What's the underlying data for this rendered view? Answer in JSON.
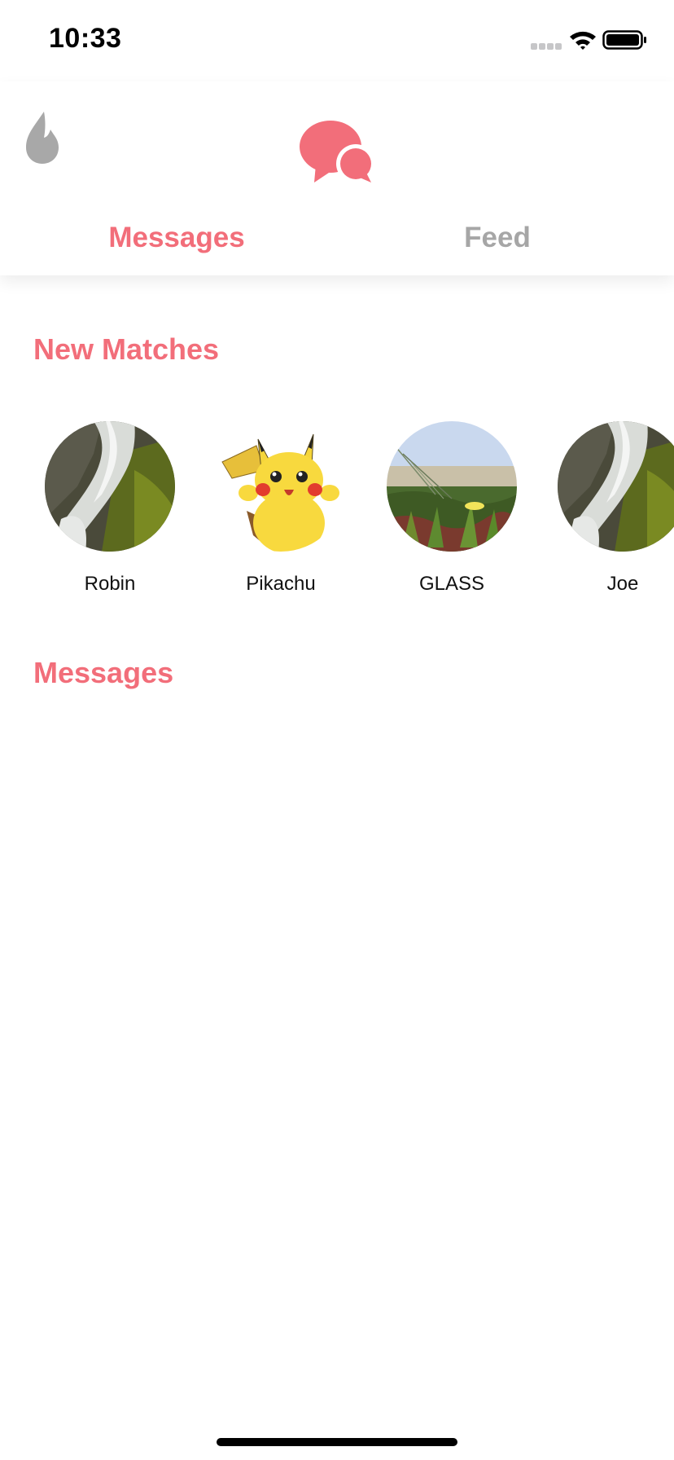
{
  "status_bar": {
    "time": "10:33"
  },
  "header": {
    "icons": [
      "flame-icon",
      "chat-bubbles-icon"
    ],
    "tabs": [
      {
        "label": "Messages",
        "active": true
      },
      {
        "label": "Feed",
        "active": false
      }
    ]
  },
  "new_matches": {
    "title": "New Matches",
    "items": [
      {
        "name": "Robin",
        "photo": "waterfall"
      },
      {
        "name": "Pikachu",
        "photo": "pikachu"
      },
      {
        "name": "GLASS",
        "photo": "ice-plant-flowers"
      },
      {
        "name": "Joe",
        "photo": "waterfall"
      }
    ]
  },
  "messages": {
    "title": "Messages"
  },
  "colors": {
    "accent": "#f26e7a",
    "inactive": "#a6a6a6",
    "icon_gray": "#a8a8a8"
  }
}
